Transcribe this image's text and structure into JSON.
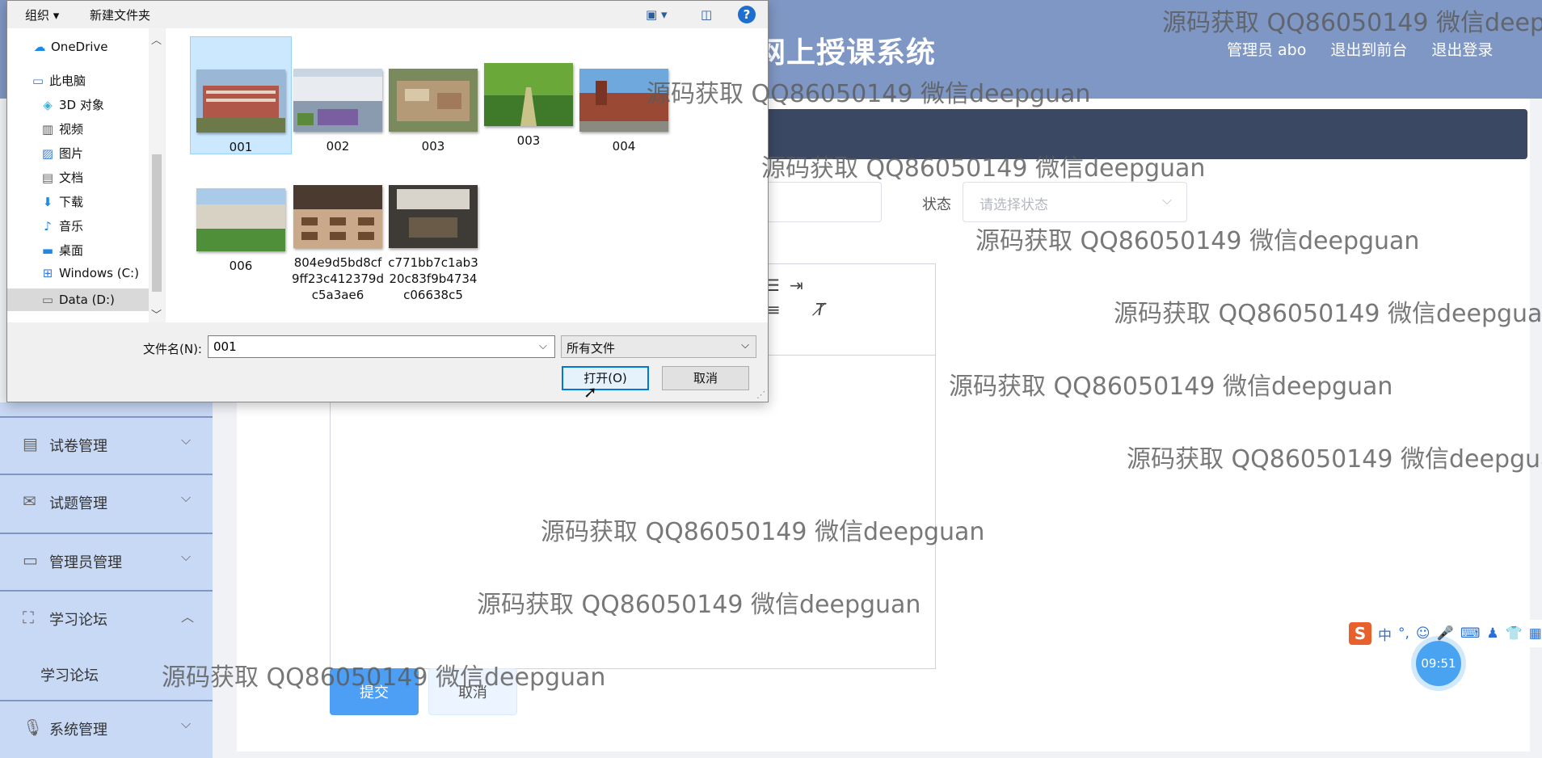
{
  "app": {
    "title": "网上授课系统",
    "header_links": [
      "管理员 abo",
      "退出到前台",
      "退出登录"
    ],
    "status_label": "状态",
    "status_placeholder": "请选择状态",
    "submit_label": "提交",
    "cancel_label": "取消"
  },
  "sidebar": {
    "items": [
      {
        "label": "试卷管理",
        "icon": "clipboard-icon",
        "chevron": "chevron-down"
      },
      {
        "label": "试题管理",
        "icon": "mail-icon",
        "chevron": "chevron-down"
      },
      {
        "label": "管理员管理",
        "icon": "id-card-icon",
        "chevron": "chevron-down"
      },
      {
        "label": "学习论坛",
        "icon": "fullscreen-icon",
        "chevron": "chevron-up"
      },
      {
        "label": "系统管理",
        "icon": "microphone-icon",
        "chevron": "chevron-down"
      }
    ],
    "sub_item": "学习论坛"
  },
  "dialog": {
    "toolbar": {
      "organize": "组织 ▾",
      "new_folder": "新建文件夹",
      "help": "?"
    },
    "nav": [
      {
        "label": "OneDrive",
        "icon": "cloud-icon"
      },
      {
        "label": "此电脑",
        "icon": "computer-icon"
      },
      {
        "label": "3D 对象",
        "icon": "cube-icon"
      },
      {
        "label": "视频",
        "icon": "video-icon"
      },
      {
        "label": "图片",
        "icon": "picture-icon"
      },
      {
        "label": "文档",
        "icon": "document-icon"
      },
      {
        "label": "下载",
        "icon": "download-icon"
      },
      {
        "label": "音乐",
        "icon": "music-icon"
      },
      {
        "label": "桌面",
        "icon": "desktop-icon"
      },
      {
        "label": "Windows (C:)",
        "icon": "drive-icon"
      },
      {
        "label": "Data (D:)",
        "icon": "drive-icon"
      }
    ],
    "files": [
      {
        "name": "001"
      },
      {
        "name": "002"
      },
      {
        "name": "003"
      },
      {
        "name": "003"
      },
      {
        "name": "004"
      },
      {
        "name": "006"
      },
      {
        "name": "804e9d5bd8cf9ff23c412379dc5a3ae6"
      },
      {
        "name": "c771bb7c1ab320c83f9b4734c06638c5"
      }
    ],
    "filename_label": "文件名(N):",
    "filename_value": "001",
    "filetype": "所有文件",
    "open_label": "打开(O)",
    "cancel_label": "取消"
  },
  "system": {
    "time": "09:51",
    "ime_mode": "中"
  },
  "watermark": "源码获取 QQ86050149 微信deepguan",
  "colors": {
    "header": "#7f97c4",
    "dark_bar": "#3a4863",
    "submit": "#4d9ff5",
    "sidebar": "#c8d9f5"
  }
}
